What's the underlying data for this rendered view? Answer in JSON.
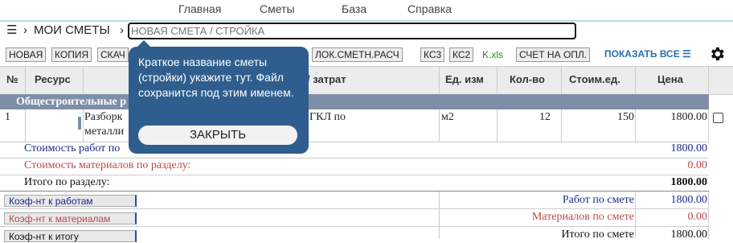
{
  "nav": {
    "items": [
      "Главная",
      "Сметы",
      "База",
      "Справка"
    ]
  },
  "breadcrumb": {
    "menu_icon": "☰",
    "sep": "›",
    "root": "МОИ СМЕТЫ"
  },
  "estimate_name": {
    "placeholder": "НОВАЯ СМЕТА / СТРОЙКА"
  },
  "toolbar": {
    "new": "НОВАЯ",
    "copy": "КОПИЯ",
    "download": "СКАЧ",
    "lok": "ЛОК.СМЕТН.РАСЧ",
    "ks3": "КС3",
    "ks2": "КС2",
    "xls": "K.xls",
    "invoice": "СЧЕТ НА ОПЛ.",
    "show_all": "ПОКАЗАТЬ ВСЕ ☰"
  },
  "table": {
    "headers": {
      "num": "№",
      "resource": "Ресурс",
      "cost_type": "/ затрат",
      "unit": "Ед. изм",
      "qty": "Кол-во",
      "unit_cost": "Стоим.ед.",
      "price": "Цена"
    },
    "section_title": "Общестроительные р",
    "rows": [
      {
        "num": "1",
        "name_line1": "Разборк",
        "name_line2": "металли",
        "desc": "з ГКЛ по",
        "unit": "м2",
        "qty": "12",
        "unit_cost": "150",
        "price": "1800.00"
      }
    ],
    "summary": {
      "work_label": "Стоимость работ по",
      "work_value": "1800.00",
      "materials_label": "Стоимость материалов по разделу:",
      "materials_value": "0.00",
      "total_label": "Итого по разделу:",
      "total_value": "1800.00"
    },
    "coefficients": {
      "work_btn": "Коэф-нт к работам",
      "work_label": "Работ по смете",
      "work_value": "1800.00",
      "materials_btn": "Коэф-нт к материалам",
      "materials_label": "Материалов по смете",
      "materials_value": "0.00",
      "total_btn": "Коэф-нт к итогу",
      "total_label": "Итого по смете",
      "total_value": "1800.00"
    }
  },
  "popup": {
    "text": "Краткое название сметы (стройки) укажите тут. Файл сохранится под этим именем.",
    "close": "ЗАКРЫТЬ"
  },
  "colors": {
    "accent": "#2f5e8e",
    "section": "#7f8ea8",
    "work_blue": "#1a2a8a",
    "materials_red": "#b94a4a"
  }
}
